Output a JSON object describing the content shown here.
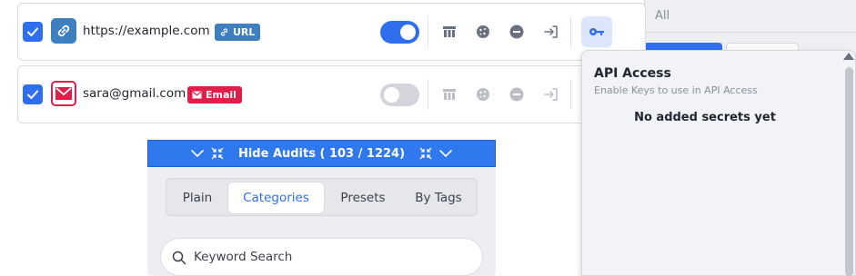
{
  "background": {
    "select_value": "All"
  },
  "rows": [
    {
      "label": "https://example.com",
      "badge": "URL",
      "checked": true,
      "enabled": true,
      "icons": [
        "checkbox-check-icon",
        "link-icon",
        "table-icon",
        "cookie-icon",
        "minus-circle-icon",
        "sign-in-icon",
        "key-icon"
      ]
    },
    {
      "label": "sara@gmail.com",
      "badge": "Email",
      "checked": true,
      "enabled": false,
      "icons": [
        "checkbox-check-icon",
        "envelope-icon",
        "table-icon",
        "cookie-icon",
        "minus-circle-icon",
        "sign-in-icon"
      ]
    }
  ],
  "audits": {
    "toggle_label": "Hide Audits ( 103 / 1224)",
    "tabs": [
      "Plain",
      "Categories",
      "Presets",
      "By Tags"
    ],
    "active_tab": "Categories",
    "search_placeholder": "Keyword Search"
  },
  "api_access": {
    "title": "API Access",
    "subtitle": "Enable Keys to use in API Access",
    "empty_text": "No added secrets yet"
  },
  "colors": {
    "accent": "#2f6fed",
    "url_badge": "#3e7fbf",
    "email_badge": "#e11d48"
  }
}
